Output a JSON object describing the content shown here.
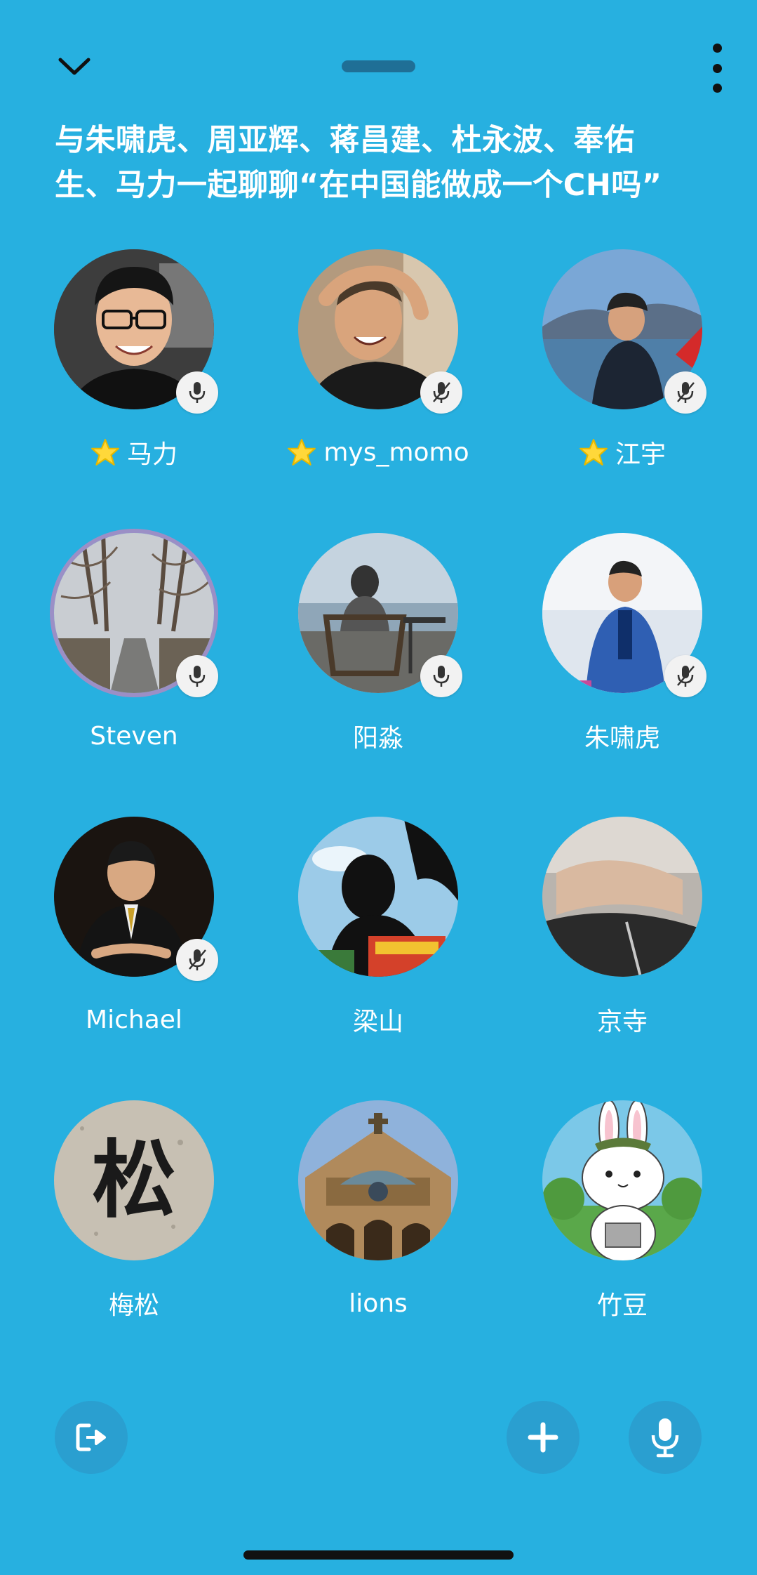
{
  "room": {
    "title": "与朱啸虎、周亚辉、蒋昌建、杜永波、奉佑生、马力一起聊聊“在中国能做成一个CH吗”"
  },
  "topbar": {
    "collapse_icon": "chevron-down-icon",
    "more_icon": "more-vertical-icon"
  },
  "speakers": [
    {
      "name": "马力",
      "moderator": true,
      "mic": "on",
      "avatar": "portrait-glasses"
    },
    {
      "name": "mys_momo",
      "moderator": true,
      "mic": "muted",
      "avatar": "portrait-laughing"
    },
    {
      "name": "江宇",
      "moderator": true,
      "mic": "muted",
      "avatar": "lake-portrait"
    },
    {
      "name": "Steven",
      "moderator": false,
      "mic": "on",
      "avatar": "tree-avenue",
      "speaking": true
    },
    {
      "name": "阳淼",
      "moderator": false,
      "mic": "on",
      "avatar": "chair-seaside"
    },
    {
      "name": "朱啸虎",
      "moderator": false,
      "mic": "muted",
      "avatar": "speaker-stage"
    },
    {
      "name": "Michael",
      "moderator": false,
      "mic": "muted",
      "avatar": "suit-portrait"
    },
    {
      "name": "梁山",
      "moderator": false,
      "mic": "none",
      "avatar": "silhouette-tree"
    },
    {
      "name": "京寺",
      "moderator": false,
      "mic": "none",
      "avatar": "blurry-hand"
    },
    {
      "name": "梅松",
      "moderator": false,
      "mic": "none",
      "avatar": "calligraphy-song"
    },
    {
      "name": "lions",
      "moderator": false,
      "mic": "none",
      "avatar": "church-facade"
    },
    {
      "name": "竹豆",
      "moderator": false,
      "mic": "none",
      "avatar": "bunny-cartoon"
    }
  ],
  "calligraphy_char": "松",
  "bottombar": {
    "leave_icon": "leave-room-icon",
    "add_icon": "plus-icon",
    "mic_icon": "microphone-icon"
  },
  "colors": {
    "background": "#27b0e0",
    "button_bg": "#2a9fd0",
    "badge_bg": "#f2f2f2",
    "star": "#ffd83a",
    "speaking_ring": "#9b8fc6"
  }
}
